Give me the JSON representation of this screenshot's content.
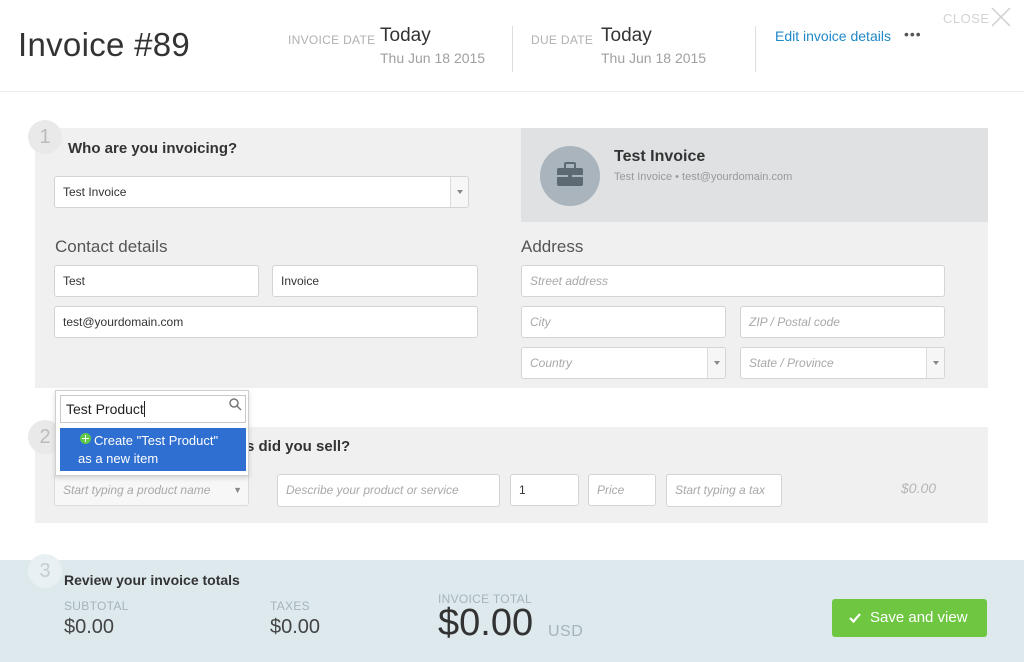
{
  "header": {
    "title": "Invoice #89",
    "invoice_date_label": "INVOICE DATE",
    "invoice_date_value": "Today",
    "invoice_date_sub": "Thu Jun 18 2015",
    "due_date_label": "DUE DATE",
    "due_date_value": "Today",
    "due_date_sub": "Thu Jun 18 2015",
    "edit_link": "Edit invoice details",
    "more": "•••",
    "close_label": "CLOSE"
  },
  "step1": {
    "number": "1",
    "title": "Who are you invoicing?",
    "client_select": "Test Invoice",
    "contact_title": "Contact details",
    "first_name": "Test",
    "last_name": "Invoice",
    "email": "test@yourdomain.com",
    "address_title": "Address",
    "street_placeholder": "Street address",
    "city_placeholder": "City",
    "zip_placeholder": "ZIP / Postal code",
    "country_placeholder": "Country",
    "state_placeholder": "State / Province",
    "card_name": "Test Invoice",
    "card_sub": "Test Invoice • test@yourdomain.com",
    "card_icon": "briefcase-icon"
  },
  "step2": {
    "number": "2",
    "title_visible": "s did you sell?",
    "product_placeholder": "Start typing a product name",
    "description_placeholder": "Describe your product or service",
    "quantity": "1",
    "price_placeholder": "Price",
    "tax_placeholder": "Start typing a tax",
    "line_total": "$0.00"
  },
  "dropdown": {
    "search_value": "Test Product",
    "option_line1": "Create \"Test Product\"",
    "option_line2": "as a new item",
    "option_icon": "plus-circle-icon",
    "search_icon": "search-icon"
  },
  "step3": {
    "number": "3",
    "title": "Review your invoice totals",
    "subtotal_label": "SUBTOTAL",
    "subtotal_value": "$0.00",
    "taxes_label": "TAXES",
    "taxes_value": "$0.00",
    "total_label": "INVOICE TOTAL",
    "total_value": "$0.00",
    "currency": "USD",
    "save_button": "Save and view"
  },
  "colors": {
    "link": "#1f88c8",
    "save_green": "#6ec641",
    "dropdown_highlight": "#2f6fd1"
  }
}
